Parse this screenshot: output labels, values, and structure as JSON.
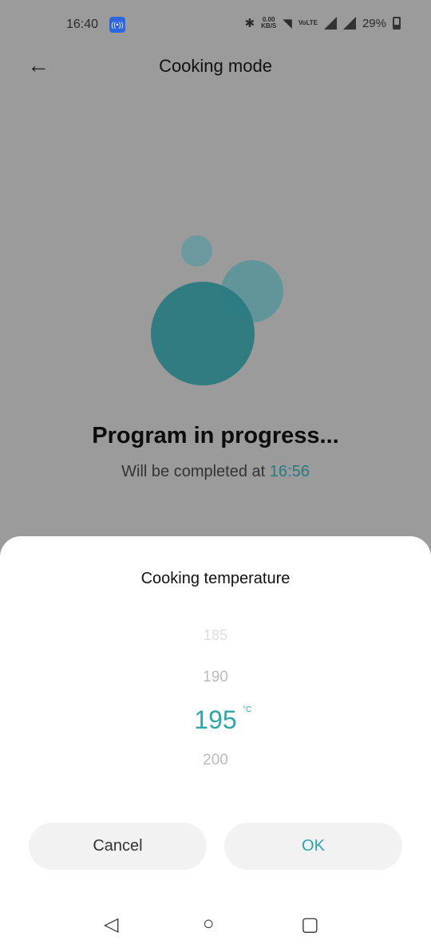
{
  "status_bar": {
    "time": "16:40",
    "hotspot_icon": "hotspot-icon",
    "net_speed": "0.00",
    "net_unit": "KB/S",
    "volte": "VoLTE",
    "battery": "29%"
  },
  "app_bar": {
    "title": "Cooking mode",
    "back_icon": "arrow-left-icon"
  },
  "main": {
    "status_title": "Program in progress...",
    "completion_prefix": "Will be completed at",
    "completion_time": "16:56",
    "accent": "#2a7a80"
  },
  "sheet": {
    "title": "Cooking temperature",
    "options": [
      "185",
      "190",
      "195",
      "200"
    ],
    "selected": "195",
    "unit": "°C",
    "cancel_label": "Cancel",
    "ok_label": "OK",
    "accent": "#2ea5a8"
  },
  "nav": {
    "back": "◁",
    "home": "○",
    "recents": "▢"
  }
}
